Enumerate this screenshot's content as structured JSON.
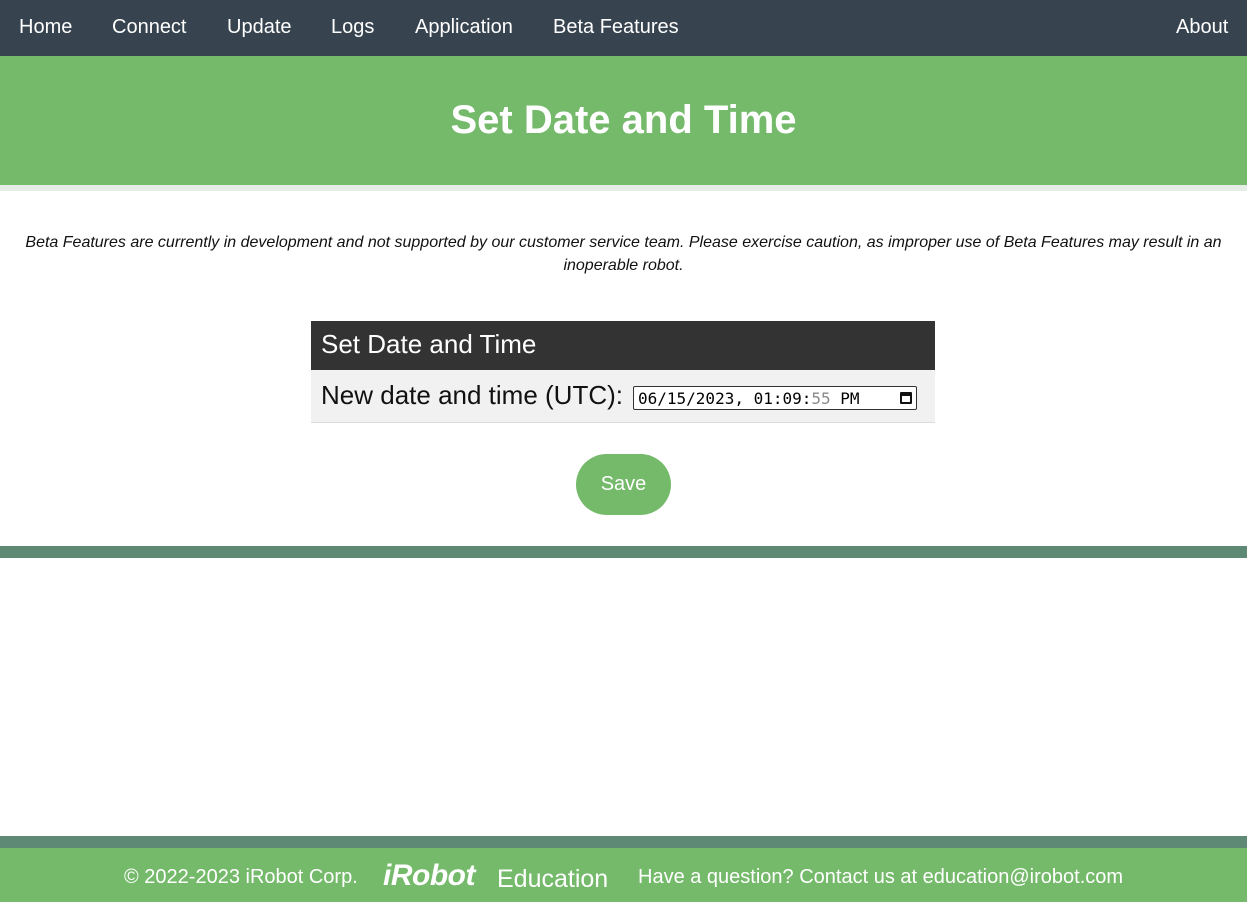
{
  "nav": {
    "home": "Home",
    "connect": "Connect",
    "update": "Update",
    "logs": "Logs",
    "application": "Application",
    "beta_features": "Beta Features",
    "about": "About"
  },
  "banner": {
    "title": "Set Date and Time"
  },
  "beta_notice": "Beta Features are currently in development and not supported by our customer service team. Please exercise caution, as improper use of Beta Features may result in an inoperable robot.",
  "form": {
    "header": "Set Date and Time",
    "field_label": "New date and time (UTC):",
    "datetime_value": {
      "main": "06/15/2023, 01:09:",
      "seconds": "55",
      "ampm": "PM"
    },
    "save_label": "Save"
  },
  "footer": {
    "copyright": "© 2022-2023 iRobot Corp.",
    "logo_brand": "iRobot",
    "logo_sub": "Education",
    "contact": "Have a question? Contact us at education@irobot.com"
  },
  "colors": {
    "nav_bg": "#37444f",
    "brand_green": "#75ba6b",
    "divider_green": "#5e8a75",
    "card_header_bg": "#333333"
  },
  "icons": {
    "date_picker": "calendar-icon"
  }
}
